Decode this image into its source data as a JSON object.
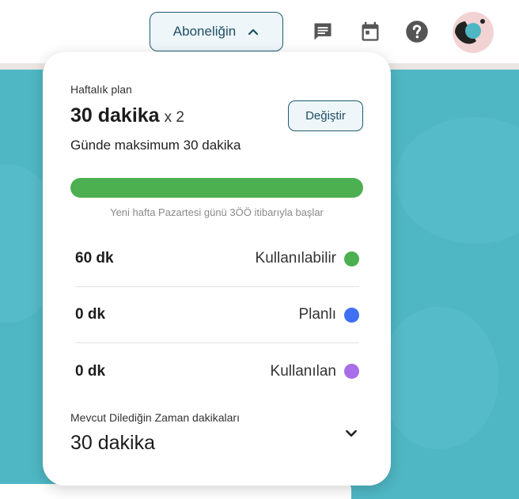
{
  "header": {
    "subscription_label": "Aboneliğin"
  },
  "plan": {
    "label": "Haftalık plan",
    "value": "30 dakika",
    "multiplier": "x 2",
    "change_label": "Değiştir",
    "daily_max": "Günde maksimum 30 dakika",
    "progress_fraction": 1.0,
    "reset_note": "Yeni hafta Pazartesi günü 3ÖÖ itibarıyla başlar"
  },
  "stats": [
    {
      "amount": "60 dk",
      "label": "Kullanılabilir",
      "color": "#4caf50"
    },
    {
      "amount": "0 dk",
      "label": "Planlı",
      "color": "#3f6ff2"
    },
    {
      "amount": "0 dk",
      "label": "Kullanılan",
      "color": "#a86ee8"
    }
  ],
  "anytime": {
    "label": "Mevcut Dilediğin Zaman dakikaları",
    "value": "30 dakika"
  },
  "colors": {
    "accent": "#1f5a73",
    "background": "#4fb7c4",
    "progress": "#4caf50"
  },
  "icons": [
    "chevron-up-icon",
    "chat-icon",
    "calendar-icon",
    "help-icon",
    "avatar",
    "chevron-down-icon"
  ]
}
